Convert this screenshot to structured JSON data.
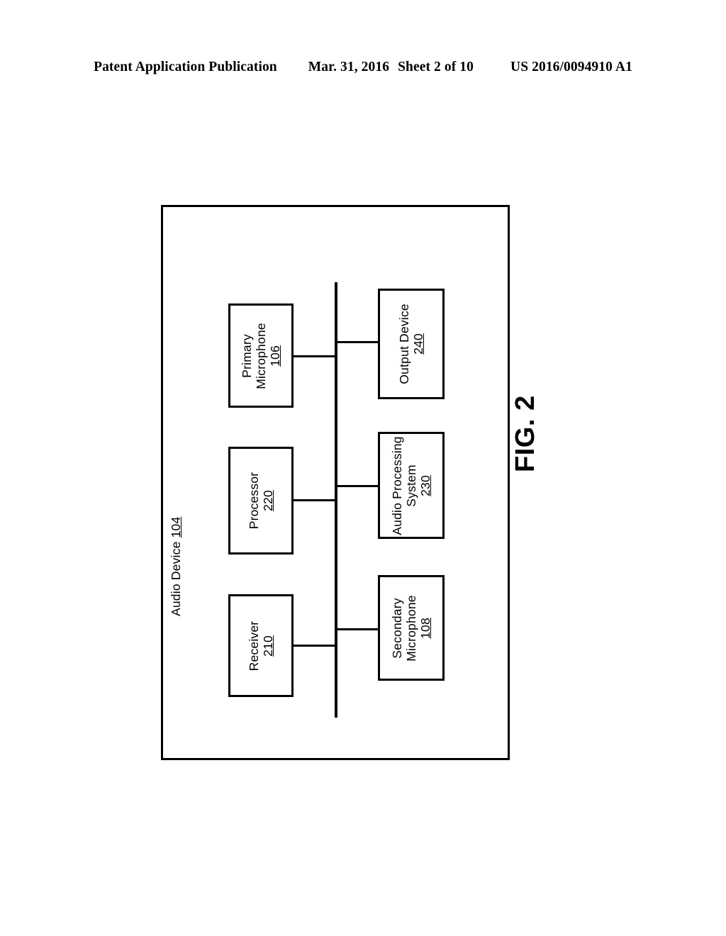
{
  "header": {
    "publication": "Patent Application Publication",
    "date": "Mar. 31, 2016",
    "sheet": "Sheet 2 of 10",
    "patent_number": "US 2016/0094910 A1"
  },
  "figure": {
    "label": "FIG. 2",
    "container": {
      "name": "Audio Device",
      "reference_number": "104"
    },
    "bus": {
      "name": "bus-line"
    },
    "blocks": [
      {
        "id": "primary-mic",
        "line1": "Primary",
        "line2": "Microphone",
        "reference_number": "106",
        "column": "left"
      },
      {
        "id": "processor",
        "line1": "Processor",
        "line2": "",
        "reference_number": "220",
        "column": "left"
      },
      {
        "id": "receiver",
        "line1": "Receiver",
        "line2": "",
        "reference_number": "210",
        "column": "left"
      },
      {
        "id": "output-device",
        "line1": "Output Device",
        "line2": "",
        "reference_number": "240",
        "column": "right"
      },
      {
        "id": "audio-proc",
        "line1": "Audio Processing",
        "line2": "System",
        "reference_number": "230",
        "column": "right"
      },
      {
        "id": "secondary-mic",
        "line1": "Secondary",
        "line2": "Microphone",
        "reference_number": "108",
        "column": "right"
      }
    ]
  },
  "colors": {
    "ink": "#000000",
    "paper": "#ffffff"
  }
}
